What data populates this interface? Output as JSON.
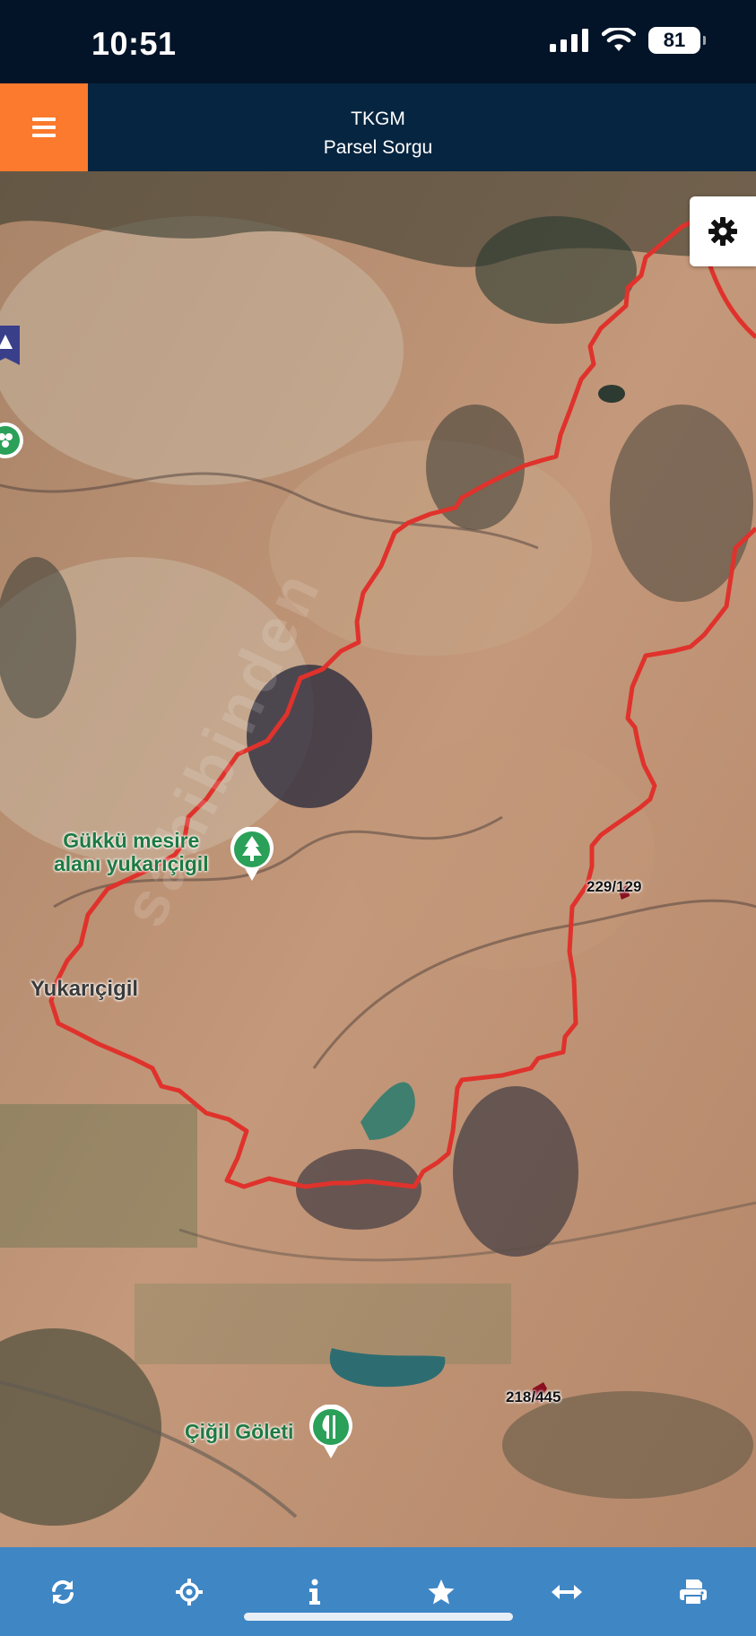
{
  "status_bar": {
    "time": "10:51",
    "battery": "81"
  },
  "header": {
    "title": "TKGM",
    "subtitle": "Parsel Sorgu"
  },
  "map": {
    "poi_labels": {
      "gukku": "Gükkü mesire\nalanı yukarıçigil",
      "cigil_goleti": "Çiğil Göleti"
    },
    "place_labels": {
      "yukaricigil": "Yukarıçigil"
    },
    "parcel_labels": {
      "p1": "229/129",
      "p2": "218/445"
    },
    "boundary_color": "#e0322c"
  },
  "toolbar": {
    "items": [
      {
        "icon": "refresh-icon"
      },
      {
        "icon": "locate-icon"
      },
      {
        "icon": "info-icon"
      },
      {
        "icon": "star-icon"
      },
      {
        "icon": "measure-icon"
      },
      {
        "icon": "print-icon"
      }
    ]
  }
}
